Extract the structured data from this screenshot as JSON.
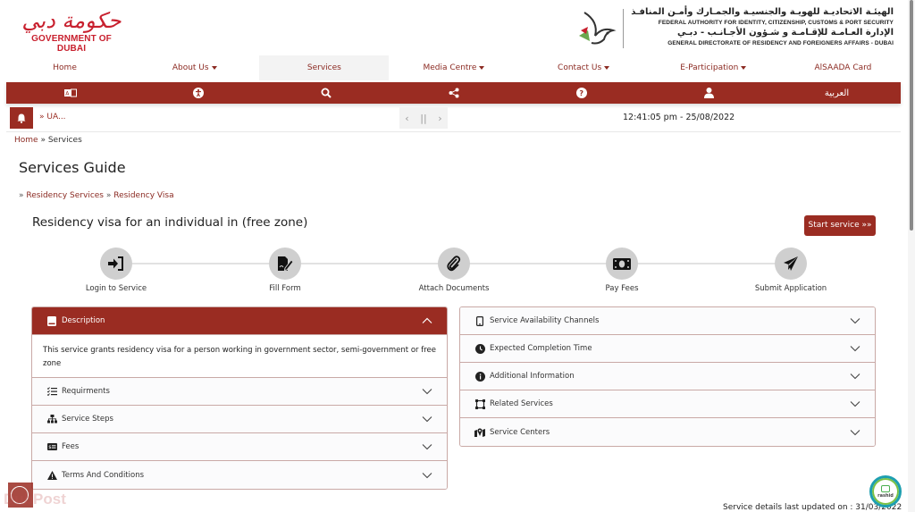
{
  "header": {
    "gov_logo_arabic": "حكومة دبي",
    "gov_logo_english": "GOVERNMENT OF DUBAI",
    "authority_lines": [
      {
        "text": "الهيئـة الاتحاديـة للهويـة والجنسيـة والجمـارك وأمـن المنافـذ",
        "lang": "ar"
      },
      {
        "text": "FEDERAL AUTHORITY FOR IDENTITY, CITIZENSHIP, CUSTOMS & PORT SECURITY",
        "lang": "en"
      },
      {
        "text": "الإدارة العـامـة للإقـامـة و شـؤون الأجـانـب - دبـي",
        "lang": "ar"
      },
      {
        "text": "GENERAL DIRECTORATE OF RESIDENCY AND FOREIGNERS AFFAIRS - DUBAI",
        "lang": "en"
      }
    ]
  },
  "main_nav": [
    {
      "label": "Home",
      "dropdown": false,
      "active": false
    },
    {
      "label": "About Us",
      "dropdown": true,
      "active": false
    },
    {
      "label": "Services",
      "dropdown": false,
      "active": true
    },
    {
      "label": "Media Centre",
      "dropdown": true,
      "active": false
    },
    {
      "label": "Contact Us",
      "dropdown": true,
      "active": false
    },
    {
      "label": "E-Participation",
      "dropdown": true,
      "active": false
    },
    {
      "label": "AlSAADA Card",
      "dropdown": false,
      "active": false
    }
  ],
  "toolbar": {
    "items": [
      {
        "icon": "font-size-icon"
      },
      {
        "icon": "accessibility-icon"
      },
      {
        "icon": "search-icon"
      },
      {
        "icon": "share-icon"
      },
      {
        "icon": "help-icon"
      },
      {
        "icon": "user-icon"
      },
      {
        "icon": "language",
        "label": "العربية"
      }
    ]
  },
  "ticker": {
    "news_text": "» UA...",
    "prev": "‹",
    "pause": "||",
    "next": "›",
    "datetime": "12:41:05 pm - 25/08/2022"
  },
  "breadcrumb": {
    "home": "Home",
    "separator": " » ",
    "current": "Services"
  },
  "page_title": "Services Guide",
  "sub_breadcrumb": {
    "sep": "» ",
    "items": [
      "Residency Services",
      "Residency Visa"
    ]
  },
  "service": {
    "title": "Residency visa for an individual in (free zone)",
    "start_button": "Start service »»"
  },
  "steps": [
    {
      "label": "Login to Service",
      "icon": "login-icon"
    },
    {
      "label": "Fill Form",
      "icon": "form-edit-icon"
    },
    {
      "label": "Attach Documents",
      "icon": "paperclip-icon"
    },
    {
      "label": "Pay Fees",
      "icon": "money-icon"
    },
    {
      "label": "Submit Application",
      "icon": "paper-plane-icon"
    }
  ],
  "left_accordion": {
    "description": {
      "title": "Description",
      "body": "This service grants residency visa for a person working in government sector, semi-government or free zone"
    },
    "sections": [
      {
        "title": "Requirments",
        "icon": "list-check-icon"
      },
      {
        "title": "Service Steps",
        "icon": "sitemap-icon"
      },
      {
        "title": "Fees",
        "icon": "money-card-icon"
      },
      {
        "title": "Terms And Conditions",
        "icon": "warning-icon"
      }
    ]
  },
  "right_accordion": {
    "sections": [
      {
        "title": "Service Availability Channels",
        "icon": "mobile-icon"
      },
      {
        "title": "Expected Completion Time",
        "icon": "clock-icon"
      },
      {
        "title": "Additional Information",
        "icon": "info-icon"
      },
      {
        "title": "Related Services",
        "icon": "vector-square-icon"
      },
      {
        "title": "Service Centers",
        "icon": "map-location-icon"
      }
    ]
  },
  "footer": {
    "updated_text": "Service details last updated on : 31/03/2022",
    "rashid_label": "rashid",
    "watermark": "DubPost"
  },
  "colors": {
    "brand_red": "#9a2c22",
    "nav_text": "#8b2a22",
    "step_circle": "#cfcfcf"
  }
}
